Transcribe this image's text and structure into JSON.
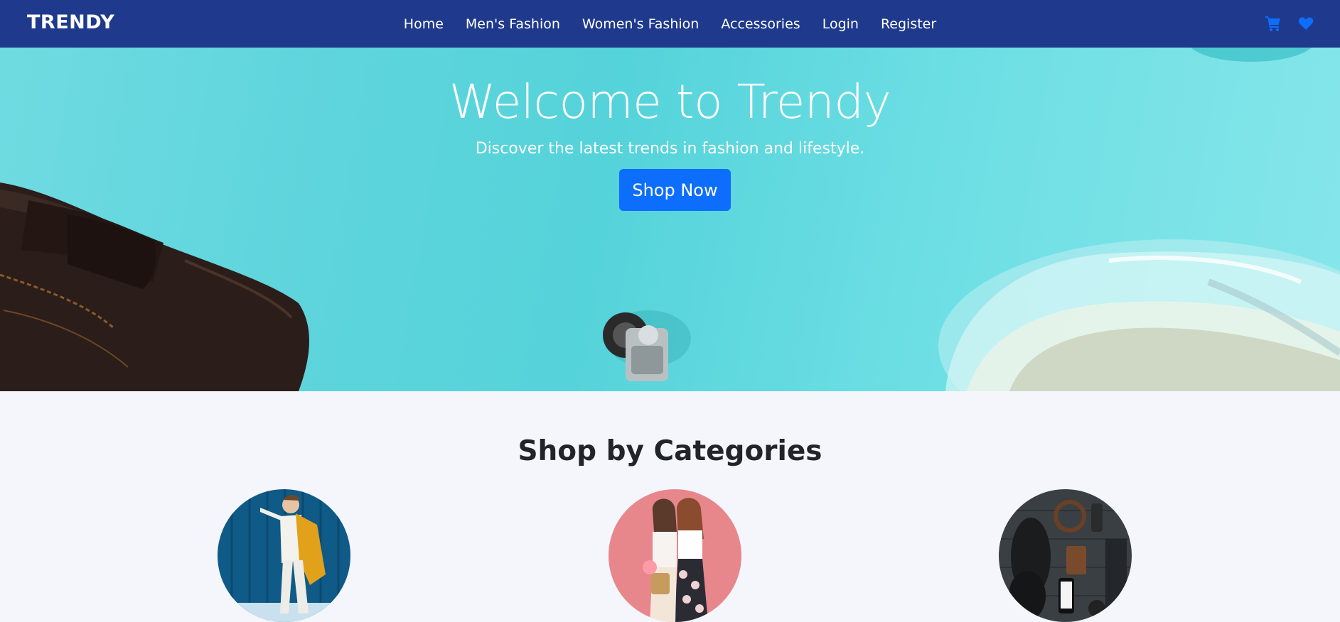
{
  "navbar": {
    "brand": "TRENDY",
    "links": [
      "Home",
      "Men's Fashion",
      "Women's Fashion",
      "Accessories",
      "Login",
      "Register"
    ],
    "icons": [
      "cart-icon",
      "heart-icon"
    ],
    "background": "#1f3a8c",
    "icon_color": "#0d6efd"
  },
  "hero": {
    "title": "Welcome to Trendy",
    "subtitle": "Discover the latest trends in fashion and lifestyle.",
    "cta_label": "Shop Now",
    "background": "#5ed4dc",
    "button_color": "#0d6efd"
  },
  "categories": {
    "title": "Shop by Categories",
    "items": [
      {
        "image": "man-with-yellow-coat"
      },
      {
        "image": "two-women-pink-background"
      },
      {
        "image": "mens-accessories-flatlay"
      }
    ]
  }
}
